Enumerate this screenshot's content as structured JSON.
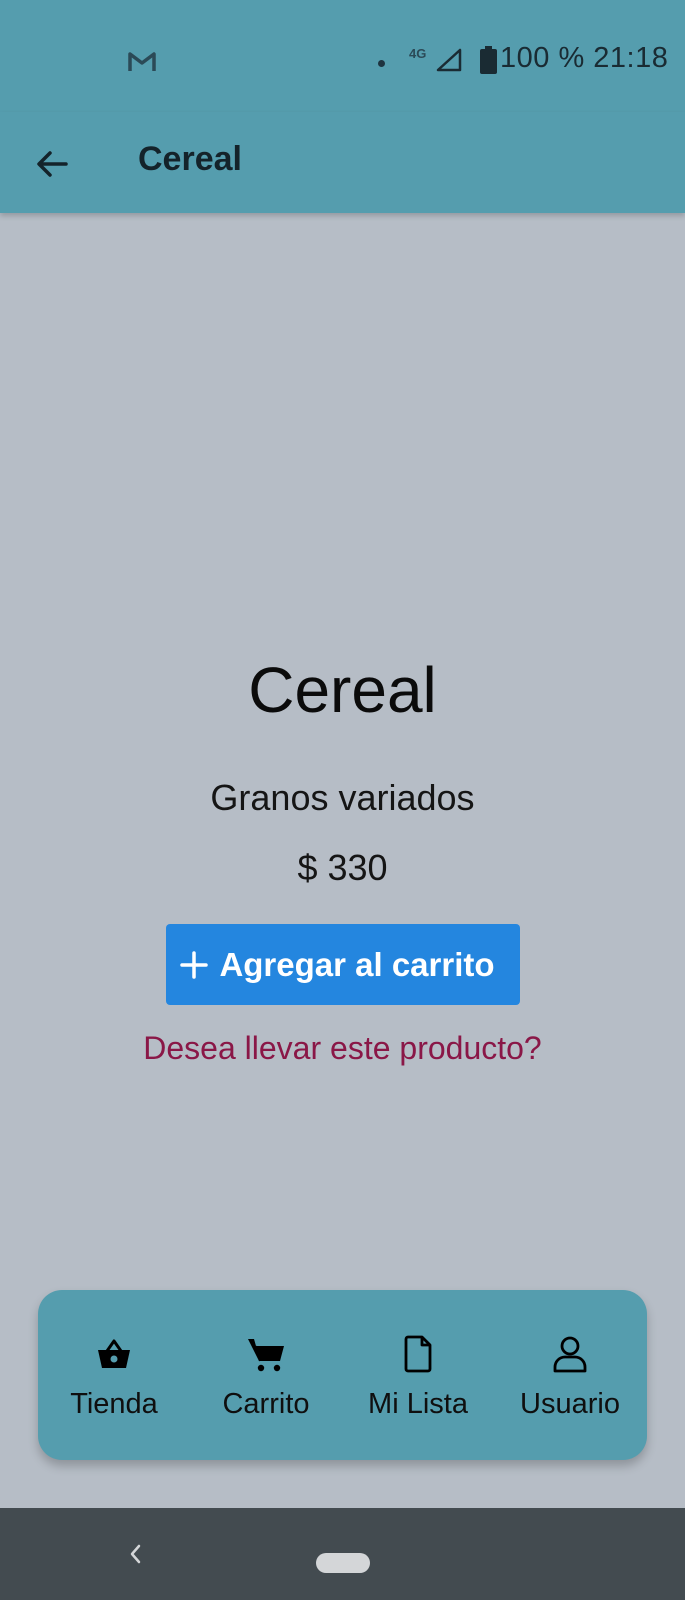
{
  "status_bar": {
    "network": "4G",
    "battery_time": "100 % 21:18"
  },
  "app_bar": {
    "title": "Cereal"
  },
  "product": {
    "name": "Cereal",
    "description": "Granos variados",
    "price": "$ 330",
    "add_button_label": "Agregar al carrito",
    "prompt": "Desea llevar este producto?"
  },
  "bottom_nav": {
    "items": [
      {
        "label": "Tienda",
        "icon": "basket-icon"
      },
      {
        "label": "Carrito",
        "icon": "cart-icon"
      },
      {
        "label": "Mi Lista",
        "icon": "document-icon"
      },
      {
        "label": "Usuario",
        "icon": "user-icon"
      }
    ]
  },
  "colors": {
    "header": "#559dae",
    "background": "#b6bdc6",
    "button": "#2486df",
    "prompt_text": "#8a1747",
    "system_nav": "#434b50"
  }
}
